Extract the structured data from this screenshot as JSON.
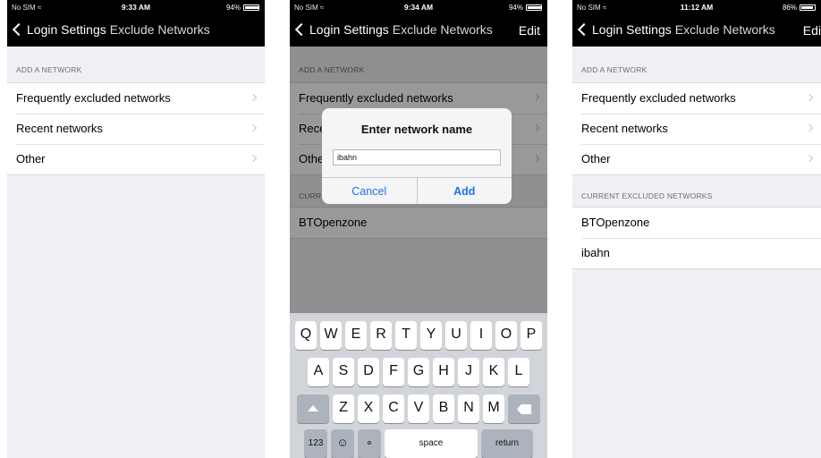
{
  "screens": [
    {
      "status": {
        "carrier": "No SIM ≈",
        "time": "9:33 AM",
        "battery": "94%"
      },
      "nav": {
        "back_label": "Login Settings",
        "title": "Exclude Networks",
        "edit": ""
      },
      "add_header": "ADD A NETWORK",
      "add_rows": [
        "Frequently excluded networks",
        "Recent networks",
        "Other"
      ]
    },
    {
      "status": {
        "carrier": "No SIM ≈",
        "time": "9:34 AM",
        "battery": "94%"
      },
      "nav": {
        "back_label": "Login Settings",
        "title": "Exclude Networks",
        "edit": "Edit"
      },
      "add_header": "ADD A NETWORK",
      "add_rows": [
        "Frequently excluded networks",
        "Recent networks",
        "Other"
      ],
      "current_header": "CURRENT EXCLUDED NETWORKS",
      "current_rows": [
        "BTOpenzone"
      ],
      "alert": {
        "title": "Enter network name",
        "field_value": "ibahn",
        "cancel": "Cancel",
        "add": "Add"
      },
      "keyboard": {
        "row1": [
          "Q",
          "W",
          "E",
          "R",
          "T",
          "Y",
          "U",
          "I",
          "O",
          "P"
        ],
        "row2": [
          "A",
          "S",
          "D",
          "F",
          "G",
          "H",
          "J",
          "K",
          "L"
        ],
        "row3": [
          "Z",
          "X",
          "C",
          "V",
          "B",
          "N",
          "M"
        ],
        "numbers": "123",
        "space": "space",
        "return": "return"
      }
    },
    {
      "status": {
        "carrier": "No SIM ≈",
        "time": "11:12 AM",
        "battery": "86%"
      },
      "nav": {
        "back_label": "Login Settings",
        "title": "Exclude Networks",
        "edit": "Edi"
      },
      "add_header": "ADD A NETWORK",
      "add_rows": [
        "Frequently excluded networks",
        "Recent networks",
        "Other"
      ],
      "current_header": "CURRENT EXCLUDED NETWORKS",
      "current_rows": [
        "BTOpenzone",
        "ibahn"
      ]
    }
  ]
}
